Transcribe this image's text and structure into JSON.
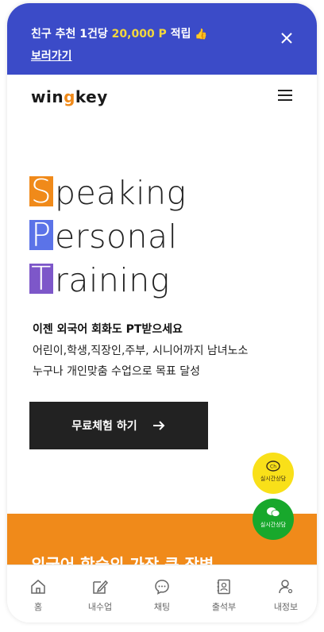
{
  "promo": {
    "prefix": "친구 추천 1건당 ",
    "amount": "20,000 P",
    "suffix": " 적립",
    "emoji": "👍",
    "link": "보러가기"
  },
  "header": {
    "logo_part1": "win",
    "logo_accent": "g",
    "logo_part2": "key"
  },
  "hero": {
    "lines": [
      {
        "first": "S",
        "rest": "peaking"
      },
      {
        "first": "P",
        "rest": "ersonal"
      },
      {
        "first": "T",
        "rest": "raining"
      }
    ],
    "title": "이젠 외국어 회화도 PT받으세요",
    "desc1": "어린이,학생,직장인,주부, 시니어까지 남녀노소",
    "desc2": "누구나 개인맞춤 수업으로 목표 달성",
    "cta": "무료체험 하기"
  },
  "floating": {
    "kakao_label": "실시간상담",
    "wechat_label": "실시간상담"
  },
  "section": {
    "title": "외국어 학습의 가장 큰 장벽"
  },
  "nav": [
    {
      "label": "홈",
      "icon": "home-icon"
    },
    {
      "label": "내수업",
      "icon": "edit-icon"
    },
    {
      "label": "채팅",
      "icon": "chat-icon"
    },
    {
      "label": "출석부",
      "icon": "attendance-icon"
    },
    {
      "label": "내정보",
      "icon": "user-icon"
    }
  ],
  "colors": {
    "promo_bg": "#3b4bc8",
    "accent_orange": "#f08a1a",
    "accent_blue": "#5b73e8",
    "accent_purple": "#7d57c9",
    "kakao": "#f9e019",
    "wechat": "#18a82c"
  }
}
